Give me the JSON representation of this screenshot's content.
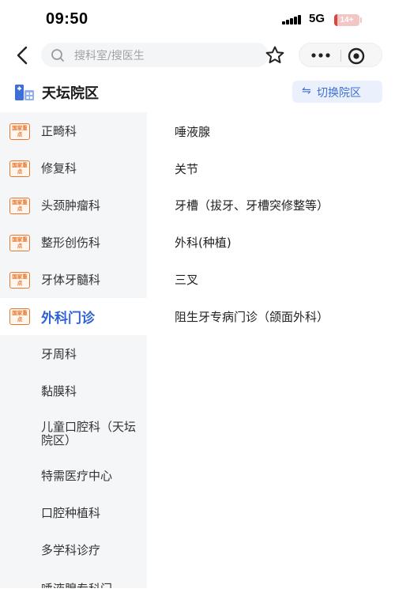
{
  "status_bar": {
    "time": "09:50",
    "network": "5G",
    "battery": "14+",
    "battery_level": 0.14
  },
  "nav": {
    "search_placeholder": "搜科室/搜医生"
  },
  "header": {
    "campus": "天坛院区",
    "switch_label": "切换院区",
    "switch_icon": "⇋"
  },
  "sidebar": {
    "badge_text": "国家重点",
    "categories": [
      {
        "label": "正畸科",
        "badge": true
      },
      {
        "label": "修复科",
        "badge": true
      },
      {
        "label": "头颈肿瘤科",
        "badge": true
      },
      {
        "label": "整形创伤科",
        "badge": true
      },
      {
        "label": "牙体牙髓科",
        "badge": true
      },
      {
        "label": "外科门诊",
        "badge": true,
        "active": true
      }
    ],
    "subcategories": [
      {
        "label": "牙周科"
      },
      {
        "label": "黏膜科"
      },
      {
        "label": "儿童口腔科（天坛院区）"
      },
      {
        "label": "特需医疗中心"
      },
      {
        "label": "口腔种植科"
      },
      {
        "label": "多学科诊疗"
      },
      {
        "label": "唾液腺专科门"
      }
    ]
  },
  "content": {
    "items": [
      {
        "label": "唾液腺"
      },
      {
        "label": "关节"
      },
      {
        "label": "牙槽（拔牙、牙槽突修整等）"
      },
      {
        "label": "外科(种植)"
      },
      {
        "label": "三叉"
      },
      {
        "label": "阻生牙专病门诊（颌面外科）"
      }
    ]
  }
}
